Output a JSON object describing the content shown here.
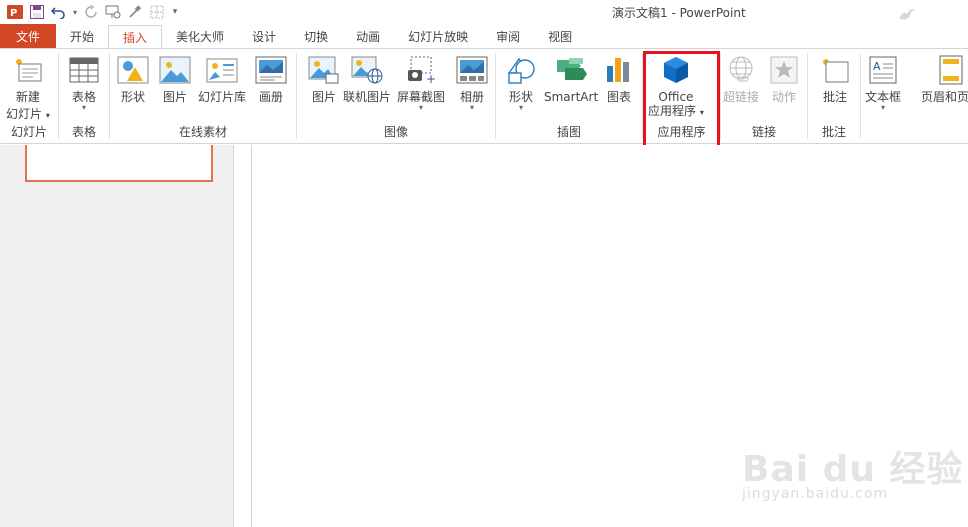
{
  "window": {
    "title": "演示文稿1 - PowerPoint"
  },
  "tabs": [
    "文件",
    "开始",
    "插入",
    "美化大师",
    "设计",
    "切换",
    "动画",
    "幻灯片放映",
    "审阅",
    "视图"
  ],
  "active_tab": "插入",
  "ribbon": {
    "slides": {
      "label": "幻灯片",
      "new_slide_line1": "新建",
      "new_slide_line2": "幻灯片"
    },
    "tables": {
      "label": "表格",
      "table": "表格"
    },
    "online": {
      "label": "在线素材",
      "shapes": "形状",
      "pictures": "图片",
      "slide_library": "幻灯片库",
      "album": "画册"
    },
    "images": {
      "label": "图像",
      "pictures": "图片",
      "online_pictures": "联机图片",
      "screenshot": "屏幕截图",
      "album": "相册"
    },
    "illustrations": {
      "label": "插图",
      "shapes": "形状",
      "smartart": "SmartArt",
      "chart": "图表"
    },
    "apps": {
      "label": "应用程序",
      "office_line1": "Office",
      "office_line2": "应用程序"
    },
    "links": {
      "label": "链接",
      "hyperlink": "超链接",
      "action": "动作"
    },
    "comments": {
      "label": "批注",
      "comment": "批注"
    },
    "text": {
      "textbox": "文本框",
      "header_footer": "页眉和页脚"
    }
  },
  "watermark": {
    "brand": "Bai du 经验",
    "url": "jingyan.baidu.com"
  },
  "colors": {
    "accent": "#d24726",
    "highlight": "#e81123",
    "office_blue": "#0f6fc6"
  }
}
